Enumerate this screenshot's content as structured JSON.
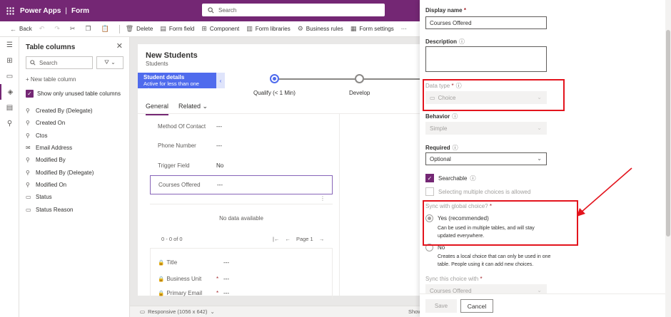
{
  "topbar": {
    "app_name": "Power Apps",
    "separator": "|",
    "section": "Form",
    "search_placeholder": "Search"
  },
  "command_bar": {
    "back": "Back",
    "delete": "Delete",
    "form_field": "Form field",
    "component": "Component",
    "form_libraries": "Form libraries",
    "business_rules": "Business rules",
    "form_settings": "Form settings",
    "more": "···"
  },
  "columns_panel": {
    "title": "Table columns",
    "search_placeholder": "Search",
    "new_column": "+ New table column",
    "show_unused": "Show only unused table columns",
    "items": [
      {
        "label": "Created By (Delegate)",
        "icon": "lookup-icon"
      },
      {
        "label": "Created On",
        "icon": "lookup-icon"
      },
      {
        "label": "Ctos",
        "icon": "lookup-icon"
      },
      {
        "label": "Email Address",
        "icon": "email-icon"
      },
      {
        "label": "Modified By",
        "icon": "lookup-icon"
      },
      {
        "label": "Modified By (Delegate)",
        "icon": "lookup-icon"
      },
      {
        "label": "Modified On",
        "icon": "lookup-icon"
      },
      {
        "label": "Status",
        "icon": "option-icon"
      },
      {
        "label": "Status Reason",
        "icon": "option-icon"
      }
    ]
  },
  "form": {
    "title": "New Students",
    "subtitle": "Students",
    "bpf": {
      "stage_title": "Student details",
      "stage_sub": "Active for less than one mi...",
      "stages": [
        "Qualify  (< 1 Min)",
        "Develop"
      ]
    },
    "tabs": [
      "General",
      "Related ⌄"
    ],
    "fields": [
      {
        "label": "Method Of Contact",
        "value": "---"
      },
      {
        "label": "Phone Number",
        "value": "---"
      },
      {
        "label": "Trigger Field",
        "value": "No"
      },
      {
        "label": "Courses Offered",
        "value": "---"
      }
    ],
    "grid_empty": "No data available",
    "pager_info": "0 - 0 of 0",
    "pager_page": "Page 1",
    "section2": [
      {
        "label": "Title",
        "required": "",
        "value": "---"
      },
      {
        "label": "Business Unit",
        "required": "*",
        "value": "---"
      },
      {
        "label": "Primary Email",
        "required": "*",
        "value": "---"
      }
    ]
  },
  "statusbar": {
    "responsive": "Responsive (1056 x 642)",
    "show": "Show"
  },
  "properties": {
    "display_name_label": "Display name",
    "display_name_value": "Courses Offered",
    "description_label": "Description",
    "data_type_label": "Data type",
    "data_type_value": "Choice",
    "behavior_label": "Behavior",
    "behavior_value": "Simple",
    "required_label": "Required",
    "required_value": "Optional",
    "searchable_label": "Searchable",
    "multiple_label": "Selecting multiple choices is allowed",
    "sync_label": "Sync with global choice?",
    "yes_label": "Yes (recommended)",
    "yes_desc": "Can be used in multiple tables, and will stay updated everywhere.",
    "no_label": "No",
    "no_desc": "Creates a local choice that can only be used in one table. People using it can add new choices.",
    "sync_choice_label": "Sync this choice with",
    "sync_choice_value": "Courses Offered",
    "save": "Save",
    "cancel": "Cancel",
    "required_mark": "*"
  },
  "colors": {
    "brand": "#742774",
    "bpf_blue": "#4f6bed",
    "highlight_red": "#e3141d"
  }
}
